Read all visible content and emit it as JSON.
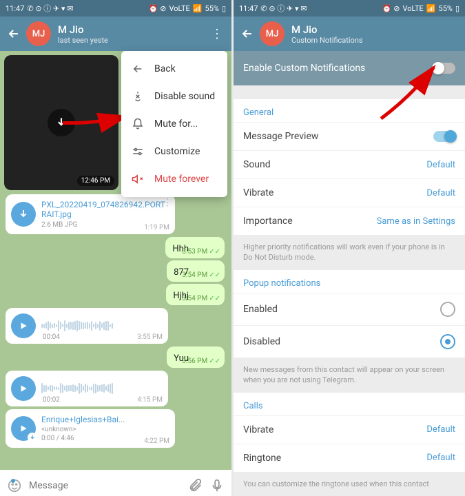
{
  "statusbar": {
    "time": "11:47",
    "battery": "55%",
    "net": "VoLTE"
  },
  "left": {
    "title": "M Jio",
    "subtitle": "last seen yeste",
    "avatar": "MJ",
    "menu": [
      {
        "icon": "back",
        "label": "Back"
      },
      {
        "icon": "sound-off",
        "label": "Disable sound"
      },
      {
        "icon": "bell",
        "label": "Mute for..."
      },
      {
        "icon": "customize",
        "label": "Customize"
      },
      {
        "icon": "mute",
        "label": "Mute forever",
        "red": true
      }
    ],
    "media_time": "12:46 PM",
    "file": {
      "name": "PXL_20220419_074826942.PORTRAIT.jpg",
      "meta": "2.6 MB JPG",
      "time": "1:19 PM"
    },
    "out": [
      {
        "txt": "Hhh",
        "time": "3:53 PM"
      },
      {
        "txt": "877",
        "time": "3:54 PM"
      },
      {
        "txt": "Hjhj",
        "time": "3:54 PM"
      }
    ],
    "voice1": {
      "dur": "00:04",
      "time": "3:55 PM"
    },
    "out2": {
      "txt": "Yuu",
      "time": "3:56 PM"
    },
    "voice2": {
      "dur": "00:02",
      "time": "4:15 PM"
    },
    "audio": {
      "name": "Enrique+Iglesias+Bai...",
      "artist": "<unknown>",
      "pos": "0:00 / 4:46",
      "time": "4:22 PM"
    },
    "input_placeholder": "Message"
  },
  "right": {
    "title": "M Jio",
    "subtitle": "Custom Notifications",
    "avatar": "MJ",
    "enable": "Enable Custom Notifications",
    "sections": {
      "general": {
        "title": "General",
        "rows": [
          {
            "label": "Message Preview",
            "toggle": true
          },
          {
            "label": "Sound",
            "val": "Default"
          },
          {
            "label": "Vibrate",
            "val": "Default"
          },
          {
            "label": "Importance",
            "val": "Same as in Settings"
          }
        ],
        "hint": "Higher priority notifications will work even if your phone is in Do Not Disturb mode."
      },
      "popup": {
        "title": "Popup notifications",
        "rows": [
          {
            "label": "Enabled",
            "radio": false
          },
          {
            "label": "Disabled",
            "radio": true
          }
        ],
        "hint": "New messages from this contact will appear on your screen when you are not using Telegram."
      },
      "calls": {
        "title": "Calls",
        "rows": [
          {
            "label": "Vibrate",
            "val": "Default"
          },
          {
            "label": "Ringtone",
            "val": "Default"
          }
        ],
        "hint": "You can customize the ringtone used when this contact"
      }
    }
  }
}
